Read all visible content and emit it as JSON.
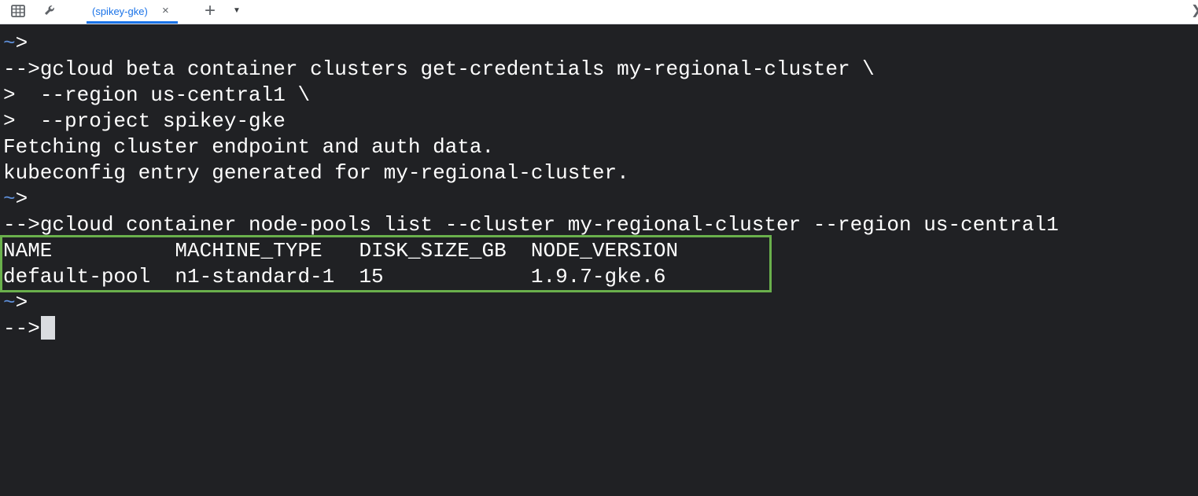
{
  "tabbar": {
    "left_icons": [
      "grid-icon",
      "wrench-icon"
    ],
    "active_tab": {
      "label": "(spikey-gke)",
      "close": "×"
    },
    "new_tab": "+",
    "menu_caret": "▼"
  },
  "terminal": {
    "prompt_marker": "~",
    "prompt_char": ">",
    "input_prefix": "-->",
    "continuation": ">",
    "commands": [
      "gcloud beta container clusters get-credentials my-regional-cluster \\",
      "  --region us-central1 \\",
      "  --project spikey-gke",
      "gcloud container node-pools list --cluster my-regional-cluster --region us-central1"
    ],
    "output": [
      "Fetching cluster endpoint and auth data.",
      "kubeconfig entry generated for my-regional-cluster."
    ],
    "table": {
      "columns": [
        "NAME",
        "MACHINE_TYPE",
        "DISK_SIZE_GB",
        "NODE_VERSION"
      ],
      "rows": [
        [
          "default-pool",
          "n1-standard-1",
          "15",
          "1.9.7-gke.6"
        ]
      ]
    }
  },
  "colors": {
    "background": "#202124",
    "text": "#ffffff",
    "prompt_tilde": "#5e8fd8",
    "highlight_border": "#6ab04c",
    "tab_accent": "#1a73e8"
  }
}
